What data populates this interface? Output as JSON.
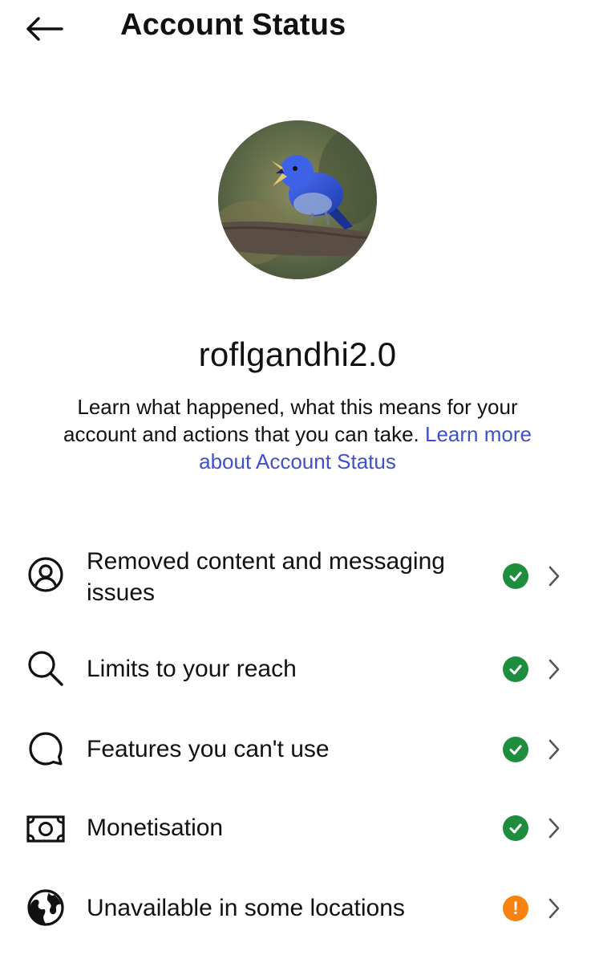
{
  "header": {
    "title": "Account Status",
    "back_icon": "arrow-left-icon"
  },
  "profile": {
    "username": "roflgandhi2.0",
    "avatar": "blue-bird-avatar"
  },
  "description": {
    "text": "Learn what happened, what this means for your account and actions that you can take. ",
    "link_text": "Learn more about Account Status",
    "link_color": "#3f51c8"
  },
  "status_items": [
    {
      "label": "Removed content and messaging issues",
      "icon": "user-circle-icon",
      "status": "ok"
    },
    {
      "label": "Limits to your reach",
      "icon": "search-icon",
      "status": "ok"
    },
    {
      "label": "Features you can't use",
      "icon": "speech-bubble-icon",
      "status": "ok"
    },
    {
      "label": "Monetisation",
      "icon": "banknote-icon",
      "status": "ok"
    },
    {
      "label": "Unavailable in some locations",
      "icon": "globe-icon",
      "status": "warning",
      "status_mark": "!"
    }
  ],
  "colors": {
    "ok": "#1e8e3e",
    "warning": "#f7820f"
  }
}
